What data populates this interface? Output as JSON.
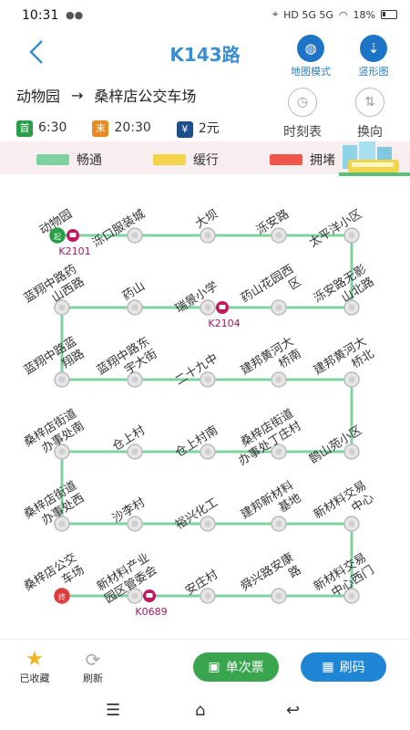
{
  "status": {
    "time": "10:31",
    "battery": "18%",
    "network": "HD 5G 5G"
  },
  "header": {
    "title": "K143路",
    "map_mode": "地图模式",
    "vertical": "竖形图"
  },
  "route": {
    "from": "动物园",
    "to": "桑梓店公交车场"
  },
  "times": {
    "first_label": "首",
    "first_time": "6:30",
    "last_label": "末",
    "last_time": "20:30",
    "price_label": "¥",
    "price": "2元"
  },
  "actions": {
    "timetable": "时刻表",
    "reverse": "换向"
  },
  "legend": [
    {
      "label": "畅通",
      "color": "#7dd3a0"
    },
    {
      "label": "缓行",
      "color": "#f4d44a"
    },
    {
      "label": "拥堵",
      "color": "#f0574a"
    }
  ],
  "line_color": "#7dd3a0",
  "stops": [
    {
      "name": "动物园",
      "start": true,
      "bus": "K2101"
    },
    {
      "name": "泺口服装城"
    },
    {
      "name": "大坝"
    },
    {
      "name": "泺安路"
    },
    {
      "name": "太平洋小区"
    },
    {
      "name": "蓝翔中路药山西路"
    },
    {
      "name": "药山"
    },
    {
      "name": "瑞景小学",
      "bus": "K2104"
    },
    {
      "name": "药山花园西区"
    },
    {
      "name": "泺安路无影山北路"
    },
    {
      "name": "蓝翔中路蓝翔路"
    },
    {
      "name": "蓝翔中路东宇大街"
    },
    {
      "name": "二十九中"
    },
    {
      "name": "建邦黄河大桥南"
    },
    {
      "name": "建邦黄河大桥北"
    },
    {
      "name": "桑梓店街道办事处南"
    },
    {
      "name": "仓上村"
    },
    {
      "name": "仓上村南"
    },
    {
      "name": "桑梓店街道办事处丁庄村"
    },
    {
      "name": "鹊山苑小区"
    },
    {
      "name": "桑梓店街道办事处西"
    },
    {
      "name": "沙李村"
    },
    {
      "name": "裕兴化工"
    },
    {
      "name": "建邦新材料基地"
    },
    {
      "name": "新材料交易中心"
    },
    {
      "name": "桑梓店公交车场",
      "end": true
    },
    {
      "name": "新材料产业园区管委会",
      "bus": "K0689"
    },
    {
      "name": "安庄村"
    },
    {
      "name": "舜兴路安康路"
    },
    {
      "name": "新材料交易中心西门"
    }
  ],
  "bottom": {
    "favorite": "已收藏",
    "refresh": "刷新",
    "ticket": "单次票",
    "scan": "刷码"
  }
}
